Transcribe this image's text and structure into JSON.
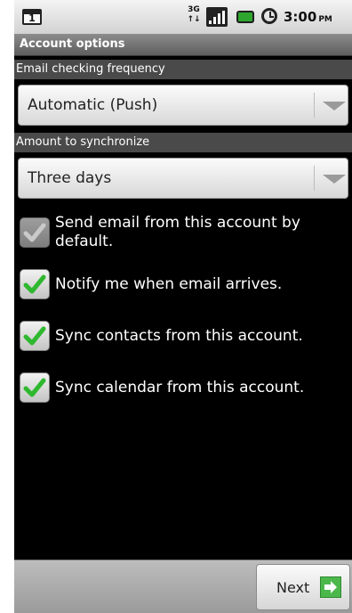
{
  "status_bar": {
    "notification_count": "1",
    "network_type": [
      "3G",
      "↑↓"
    ],
    "time": "3:00",
    "ampm": "PM"
  },
  "title_bar": {
    "title": "Account options"
  },
  "email_frequency": {
    "label": "Email checking frequency",
    "selected": "Automatic (Push)"
  },
  "sync_amount": {
    "label": "Amount to synchronize",
    "selected": "Three days"
  },
  "options": [
    {
      "label": "Send email from this account by default.",
      "checked": true,
      "enabled": false
    },
    {
      "label": "Notify me when email arrives.",
      "checked": true,
      "enabled": true
    },
    {
      "label": "Sync contacts from this account.",
      "checked": true,
      "enabled": true
    },
    {
      "label": "Sync calendar from this account.",
      "checked": true,
      "enabled": true
    }
  ],
  "footer": {
    "next_label": "Next"
  },
  "colors": {
    "check_green": "#2fb82f",
    "check_disabled": "#c9c9c9",
    "next_arrow_bg": "#4cb84c"
  },
  "icons": {
    "notification": "notification-icon",
    "network": "3g-icon",
    "signal": "signal-icon",
    "battery": "battery-icon",
    "alarm": "alarm-icon",
    "dropdown": "chevron-down-icon",
    "check": "checkmark-icon",
    "next": "arrow-right-icon"
  }
}
